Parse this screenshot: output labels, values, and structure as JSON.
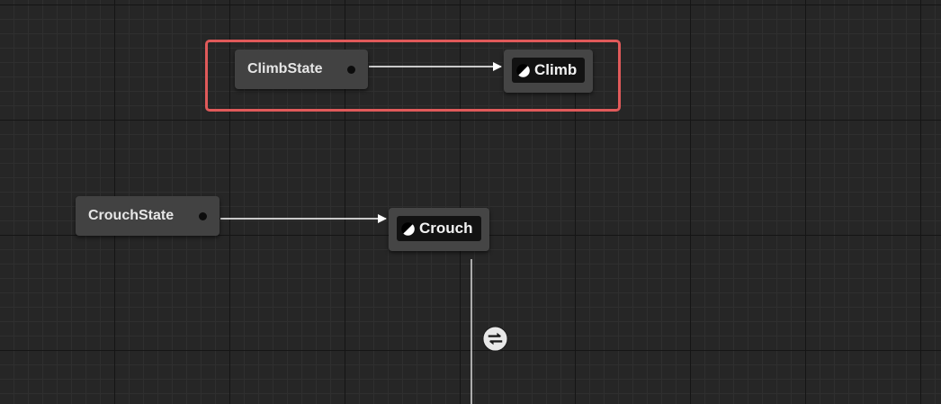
{
  "graph": {
    "highlight_color": "#e05a5a",
    "entry_nodes": [
      {
        "label": "ClimbState"
      },
      {
        "label": "CrouchState"
      }
    ],
    "state_nodes": [
      {
        "label": "Climb",
        "icon": "state-icon"
      },
      {
        "label": "Crouch",
        "icon": "state-icon"
      }
    ],
    "transition": {
      "icon": "transition-swap-icon"
    }
  }
}
